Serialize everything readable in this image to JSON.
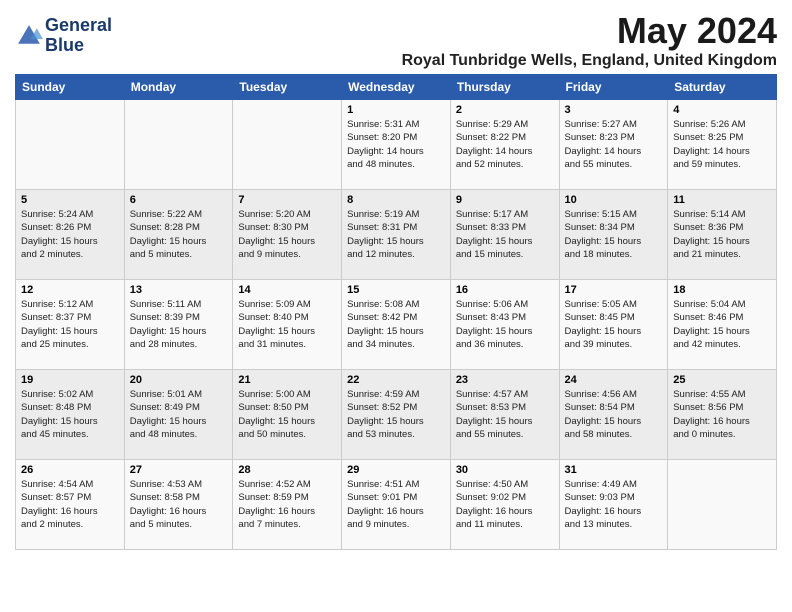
{
  "logo": {
    "line1": "General",
    "line2": "Blue"
  },
  "title": "May 2024",
  "location": "Royal Tunbridge Wells, England, United Kingdom",
  "weekdays": [
    "Sunday",
    "Monday",
    "Tuesday",
    "Wednesday",
    "Thursday",
    "Friday",
    "Saturday"
  ],
  "weeks": [
    [
      {
        "day": "",
        "info": ""
      },
      {
        "day": "",
        "info": ""
      },
      {
        "day": "",
        "info": ""
      },
      {
        "day": "1",
        "info": "Sunrise: 5:31 AM\nSunset: 8:20 PM\nDaylight: 14 hours\nand 48 minutes."
      },
      {
        "day": "2",
        "info": "Sunrise: 5:29 AM\nSunset: 8:22 PM\nDaylight: 14 hours\nand 52 minutes."
      },
      {
        "day": "3",
        "info": "Sunrise: 5:27 AM\nSunset: 8:23 PM\nDaylight: 14 hours\nand 55 minutes."
      },
      {
        "day": "4",
        "info": "Sunrise: 5:26 AM\nSunset: 8:25 PM\nDaylight: 14 hours\nand 59 minutes."
      }
    ],
    [
      {
        "day": "5",
        "info": "Sunrise: 5:24 AM\nSunset: 8:26 PM\nDaylight: 15 hours\nand 2 minutes."
      },
      {
        "day": "6",
        "info": "Sunrise: 5:22 AM\nSunset: 8:28 PM\nDaylight: 15 hours\nand 5 minutes."
      },
      {
        "day": "7",
        "info": "Sunrise: 5:20 AM\nSunset: 8:30 PM\nDaylight: 15 hours\nand 9 minutes."
      },
      {
        "day": "8",
        "info": "Sunrise: 5:19 AM\nSunset: 8:31 PM\nDaylight: 15 hours\nand 12 minutes."
      },
      {
        "day": "9",
        "info": "Sunrise: 5:17 AM\nSunset: 8:33 PM\nDaylight: 15 hours\nand 15 minutes."
      },
      {
        "day": "10",
        "info": "Sunrise: 5:15 AM\nSunset: 8:34 PM\nDaylight: 15 hours\nand 18 minutes."
      },
      {
        "day": "11",
        "info": "Sunrise: 5:14 AM\nSunset: 8:36 PM\nDaylight: 15 hours\nand 21 minutes."
      }
    ],
    [
      {
        "day": "12",
        "info": "Sunrise: 5:12 AM\nSunset: 8:37 PM\nDaylight: 15 hours\nand 25 minutes."
      },
      {
        "day": "13",
        "info": "Sunrise: 5:11 AM\nSunset: 8:39 PM\nDaylight: 15 hours\nand 28 minutes."
      },
      {
        "day": "14",
        "info": "Sunrise: 5:09 AM\nSunset: 8:40 PM\nDaylight: 15 hours\nand 31 minutes."
      },
      {
        "day": "15",
        "info": "Sunrise: 5:08 AM\nSunset: 8:42 PM\nDaylight: 15 hours\nand 34 minutes."
      },
      {
        "day": "16",
        "info": "Sunrise: 5:06 AM\nSunset: 8:43 PM\nDaylight: 15 hours\nand 36 minutes."
      },
      {
        "day": "17",
        "info": "Sunrise: 5:05 AM\nSunset: 8:45 PM\nDaylight: 15 hours\nand 39 minutes."
      },
      {
        "day": "18",
        "info": "Sunrise: 5:04 AM\nSunset: 8:46 PM\nDaylight: 15 hours\nand 42 minutes."
      }
    ],
    [
      {
        "day": "19",
        "info": "Sunrise: 5:02 AM\nSunset: 8:48 PM\nDaylight: 15 hours\nand 45 minutes."
      },
      {
        "day": "20",
        "info": "Sunrise: 5:01 AM\nSunset: 8:49 PM\nDaylight: 15 hours\nand 48 minutes."
      },
      {
        "day": "21",
        "info": "Sunrise: 5:00 AM\nSunset: 8:50 PM\nDaylight: 15 hours\nand 50 minutes."
      },
      {
        "day": "22",
        "info": "Sunrise: 4:59 AM\nSunset: 8:52 PM\nDaylight: 15 hours\nand 53 minutes."
      },
      {
        "day": "23",
        "info": "Sunrise: 4:57 AM\nSunset: 8:53 PM\nDaylight: 15 hours\nand 55 minutes."
      },
      {
        "day": "24",
        "info": "Sunrise: 4:56 AM\nSunset: 8:54 PM\nDaylight: 15 hours\nand 58 minutes."
      },
      {
        "day": "25",
        "info": "Sunrise: 4:55 AM\nSunset: 8:56 PM\nDaylight: 16 hours\nand 0 minutes."
      }
    ],
    [
      {
        "day": "26",
        "info": "Sunrise: 4:54 AM\nSunset: 8:57 PM\nDaylight: 16 hours\nand 2 minutes."
      },
      {
        "day": "27",
        "info": "Sunrise: 4:53 AM\nSunset: 8:58 PM\nDaylight: 16 hours\nand 5 minutes."
      },
      {
        "day": "28",
        "info": "Sunrise: 4:52 AM\nSunset: 8:59 PM\nDaylight: 16 hours\nand 7 minutes."
      },
      {
        "day": "29",
        "info": "Sunrise: 4:51 AM\nSunset: 9:01 PM\nDaylight: 16 hours\nand 9 minutes."
      },
      {
        "day": "30",
        "info": "Sunrise: 4:50 AM\nSunset: 9:02 PM\nDaylight: 16 hours\nand 11 minutes."
      },
      {
        "day": "31",
        "info": "Sunrise: 4:49 AM\nSunset: 9:03 PM\nDaylight: 16 hours\nand 13 minutes."
      },
      {
        "day": "",
        "info": ""
      }
    ]
  ]
}
